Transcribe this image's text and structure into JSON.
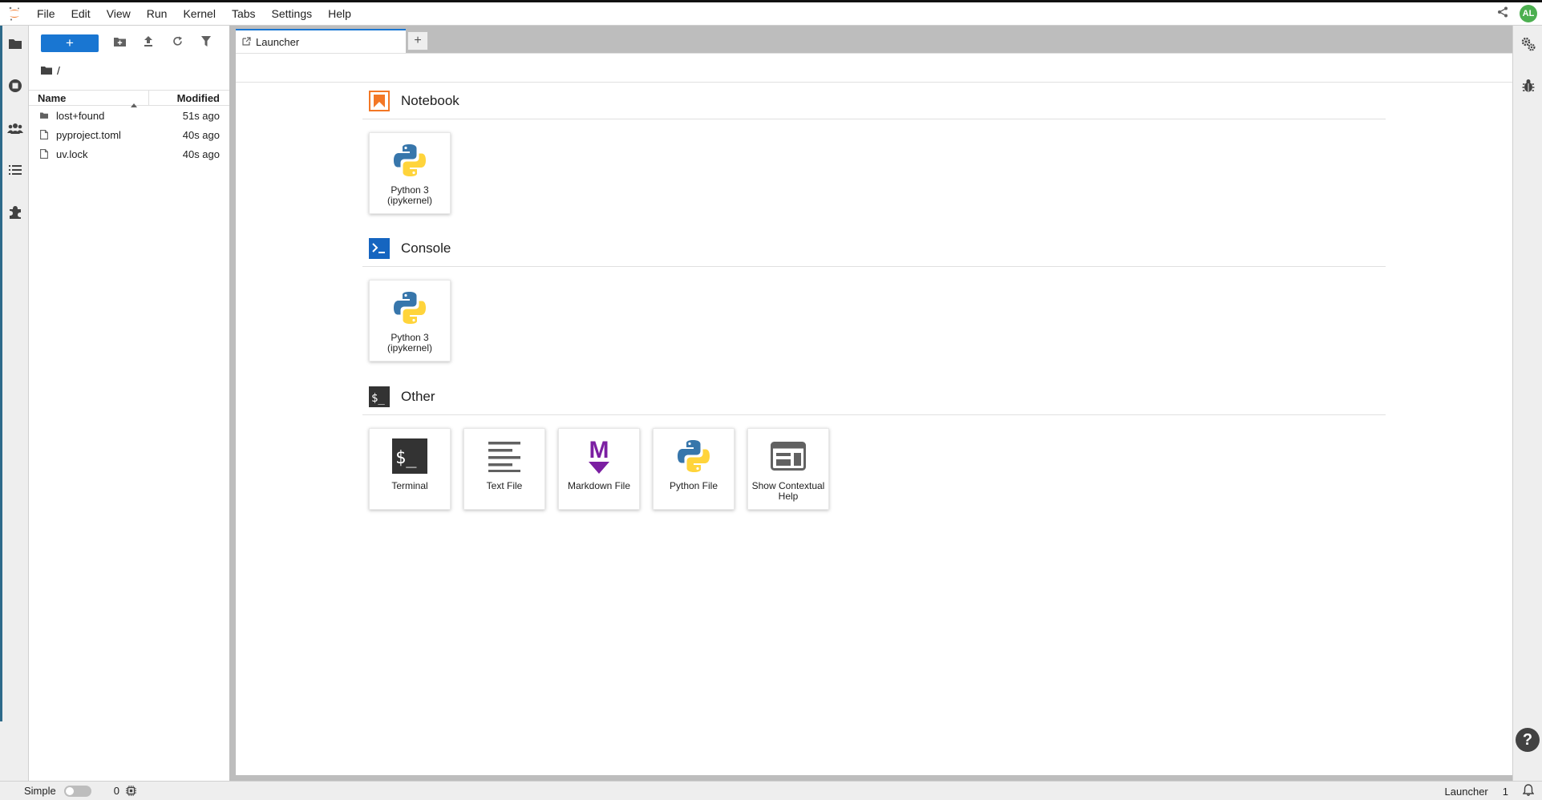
{
  "menubar": {
    "items": [
      "File",
      "Edit",
      "View",
      "Run",
      "Kernel",
      "Tabs",
      "Settings",
      "Help"
    ],
    "avatar_initials": "AL"
  },
  "filebrowser": {
    "new_button_label": "+",
    "breadcrumb": "/",
    "columns": {
      "name": "Name",
      "modified": "Modified"
    },
    "files": [
      {
        "name": "lost+found",
        "type": "folder",
        "modified": "51s ago"
      },
      {
        "name": "pyproject.toml",
        "type": "file",
        "modified": "40s ago"
      },
      {
        "name": "uv.lock",
        "type": "file",
        "modified": "40s ago"
      }
    ]
  },
  "tabs": [
    {
      "label": "Launcher",
      "icon": "launcher-icon"
    }
  ],
  "add_tab_label": "+",
  "launcher": {
    "sections": [
      {
        "title": "Notebook",
        "cards": [
          {
            "label": "Python 3 (ipykernel)",
            "icon": "python-icon"
          }
        ]
      },
      {
        "title": "Console",
        "cards": [
          {
            "label": "Python 3 (ipykernel)",
            "icon": "python-icon"
          }
        ]
      },
      {
        "title": "Other",
        "cards": [
          {
            "label": "Terminal",
            "icon": "terminal-icon"
          },
          {
            "label": "Text File",
            "icon": "text-file-icon"
          },
          {
            "label": "Markdown File",
            "icon": "markdown-icon"
          },
          {
            "label": "Python File",
            "icon": "python-icon"
          },
          {
            "label": "Show Contextual Help",
            "icon": "contextual-help-icon"
          }
        ]
      }
    ]
  },
  "statusbar": {
    "simple_label": "Simple",
    "kernel_count": "0",
    "mode": "Launcher",
    "notification_count": "1"
  },
  "help_button_label": "?",
  "colors": {
    "accent": "#1976d2",
    "notebook_orange": "#f37726",
    "console_blue": "#1565c0",
    "markdown_purple": "#7b1fa2",
    "avatar_green": "#4caf50"
  }
}
